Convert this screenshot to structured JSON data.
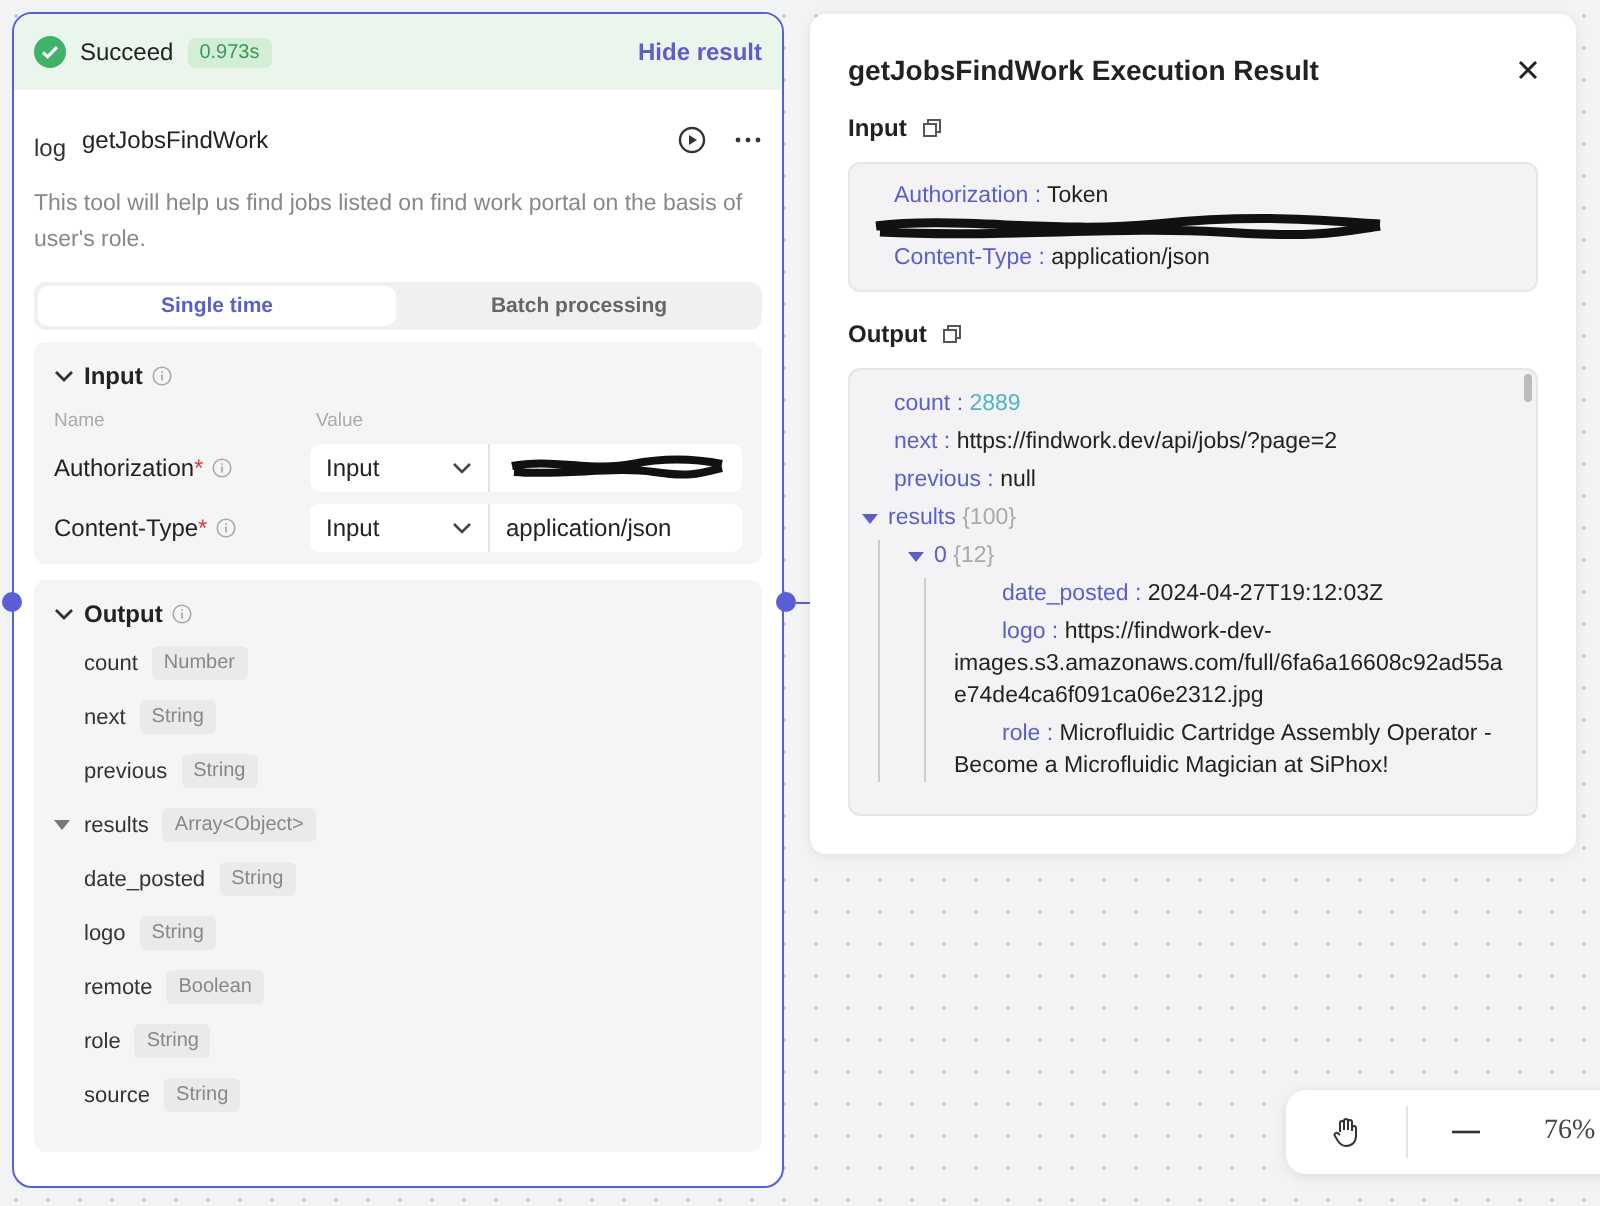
{
  "node": {
    "status": "Succeed",
    "duration": "0.973s",
    "hide_link": "Hide result",
    "logo_alt": "log",
    "title": "getJobsFindWork",
    "description": "This tool will help us find jobs listed on find work portal on the basis of user's role.",
    "tabs": [
      {
        "label": "Single time",
        "selected": true
      },
      {
        "label": "Batch processing",
        "selected": false
      }
    ],
    "input": {
      "title": "Input",
      "expanded": true,
      "columns": [
        "Name",
        "Value"
      ],
      "params": [
        {
          "name": "Authorization",
          "required_mark": "*",
          "source": "Input",
          "redacted": true
        },
        {
          "name": "Content-Type",
          "required_mark": "*",
          "source": "Input",
          "value": "application/json"
        }
      ]
    },
    "output": {
      "title": "Output",
      "expanded": true,
      "fields": [
        {
          "name": "count",
          "type": "Number"
        },
        {
          "name": "next",
          "type": "String"
        },
        {
          "name": "previous",
          "type": "String"
        },
        {
          "name": "results",
          "type": "Array<Object>",
          "expanded": true
        },
        {
          "name": "date_posted",
          "type": "String"
        },
        {
          "name": "logo",
          "type": "String"
        },
        {
          "name": "remote",
          "type": "Boolean"
        },
        {
          "name": "role",
          "type": "String"
        },
        {
          "name": "source",
          "type": "String"
        }
      ]
    }
  },
  "result_panel": {
    "title": "getJobsFindWork Execution Result",
    "input_label": "Input",
    "input": [
      {
        "key": "Authorization :",
        "value": "Token",
        "redacted": true
      },
      {
        "key": "Content-Type :",
        "value": "application/json"
      }
    ],
    "output_label": "Output",
    "output": [
      {
        "key": "count :",
        "value": "2889",
        "kind": "number"
      },
      {
        "key": "next :",
        "value": "https://findwork.dev/api/jobs/?page=2",
        "kind": "string"
      },
      {
        "key": "previous :",
        "value": "null",
        "kind": "string"
      },
      {
        "key": "results",
        "count": "{100}",
        "expanded": true,
        "children": [
          {
            "key": "0",
            "count": "{12}",
            "expanded": true,
            "children": [
              {
                "key": "date_posted :",
                "value": "2024-04-27T19:12:03Z"
              },
              {
                "key": "logo :",
                "value": "https://findwork-dev-images.s3.amazonaws.com/full/6fa6a16608c92ad55ae74de4ca6f091ca06e2312.jpg"
              },
              {
                "key": "role :",
                "value": "Microfluidic Cartridge Assembly Operator - Become a Microfluidic Magician at SiPhox!"
              }
            ]
          }
        ]
      }
    ]
  },
  "zoom": {
    "level": "76%"
  }
}
